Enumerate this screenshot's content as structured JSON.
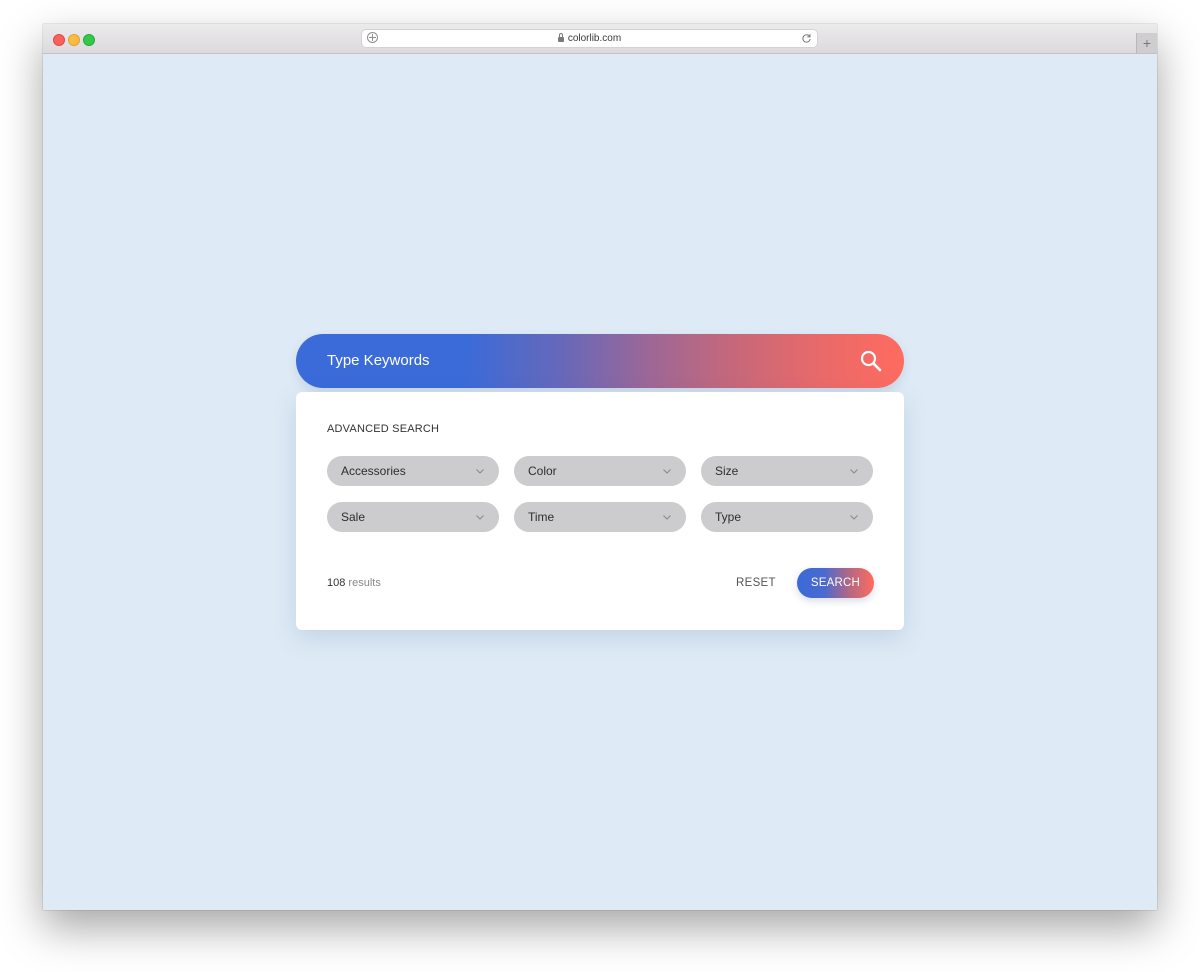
{
  "browser": {
    "url": "colorlib.com",
    "new_tab_label": "+"
  },
  "search": {
    "placeholder": "Type Keywords",
    "icon": "search-icon",
    "gradient_start": "#3a6bd8",
    "gradient_end": "#ff6b5f"
  },
  "advanced": {
    "title": "ADVANCED SEARCH",
    "filters": [
      {
        "label": "Accessories"
      },
      {
        "label": "Color"
      },
      {
        "label": "Size"
      },
      {
        "label": "Sale"
      },
      {
        "label": "Time"
      },
      {
        "label": "Type"
      }
    ]
  },
  "footer": {
    "results_count": "108",
    "results_word": "results",
    "reset_label": "RESET",
    "search_label": "SEARCH"
  },
  "colors": {
    "page_background": "#deebf6",
    "select_background": "#cccbcd",
    "panel_background": "#ffffff"
  }
}
